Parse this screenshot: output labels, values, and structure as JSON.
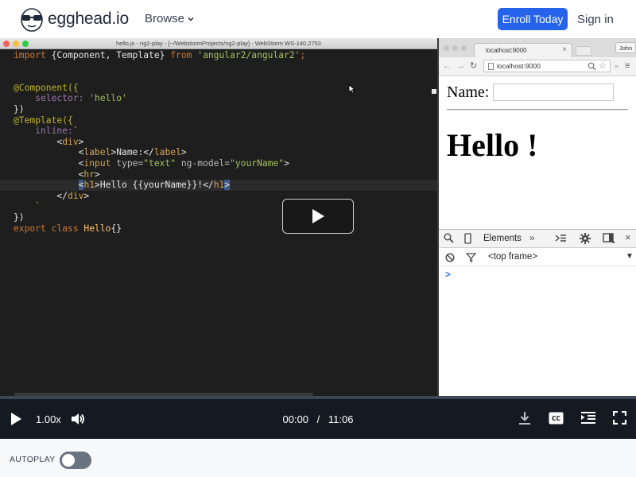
{
  "header": {
    "brand": "egghead.io",
    "browse_label": "Browse",
    "enroll_label": "Enroll Today",
    "signin_label": "Sign in"
  },
  "ide": {
    "window_title": "hello.js - ng2-play - [~/WebstormProjects/ng2-play] - WebStorm WS-140.2753"
  },
  "code_lines": [
    [
      {
        "t": "import ",
        "c": "kw2"
      },
      {
        "t": "{Component, Template} ",
        "c": ""
      },
      {
        "t": "from ",
        "c": "kw2"
      },
      {
        "t": "'angular2/angular2'",
        "c": "str"
      },
      {
        "t": ";",
        "c": "kw2"
      }
    ],
    [],
    [],
    [
      {
        "t": "@Component({",
        "c": "dec"
      }
    ],
    [
      {
        "t": "    selector: ",
        "c": "id"
      },
      {
        "t": "'hello'",
        "c": "str"
      }
    ],
    [
      {
        "t": "})",
        "c": ""
      }
    ],
    [
      {
        "t": "@Template({",
        "c": "dec"
      }
    ],
    [
      {
        "t": "    inline:",
        "c": "id"
      },
      {
        "t": "`",
        "c": "str"
      }
    ],
    [
      {
        "t": "        <",
        "c": ""
      },
      {
        "t": "div",
        "c": "tag"
      },
      {
        "t": ">",
        "c": ""
      }
    ],
    [
      {
        "t": "            <",
        "c": ""
      },
      {
        "t": "label",
        "c": "tag"
      },
      {
        "t": ">Name:</",
        "c": ""
      },
      {
        "t": "label",
        "c": "tag"
      },
      {
        "t": ">",
        "c": ""
      }
    ],
    [
      {
        "t": "            <",
        "c": ""
      },
      {
        "t": "input ",
        "c": "tag"
      },
      {
        "t": "type=",
        "c": "attr"
      },
      {
        "t": "\"text\" ",
        "c": "str"
      },
      {
        "t": "ng-model=",
        "c": "attr"
      },
      {
        "t": "\"yourName\"",
        "c": "str"
      },
      {
        "t": ">",
        "c": ""
      }
    ],
    [
      {
        "t": "            <",
        "c": ""
      },
      {
        "t": "hr",
        "c": "tag"
      },
      {
        "t": ">",
        "c": ""
      }
    ],
    [
      {
        "t": "            ",
        "c": ""
      },
      {
        "t": "<",
        "c": "sel-bg"
      },
      {
        "t": "h1",
        "c": "tag"
      },
      {
        "t": ">Hello {{yourName}}!</",
        "c": ""
      },
      {
        "t": "h1",
        "c": "tag"
      },
      {
        "t": ">",
        "c": "sel-bg"
      }
    ],
    [
      {
        "t": "        </",
        "c": ""
      },
      {
        "t": "div",
        "c": "tag"
      },
      {
        "t": ">",
        "c": ""
      }
    ],
    [
      {
        "t": "    `",
        "c": "str"
      }
    ],
    [
      {
        "t": "})",
        "c": ""
      }
    ],
    [
      {
        "t": "export class ",
        "c": "kw2"
      },
      {
        "t": "Hello",
        "c": "cls"
      },
      {
        "t": "{}",
        "c": ""
      }
    ]
  ],
  "browser": {
    "tab_title": "localhost:9000",
    "user_label": "John",
    "address": "localhost:9000",
    "page": {
      "name_label": "Name:",
      "name_value": "",
      "heading": "Hello !"
    },
    "devtools": {
      "panel_label": "Elements",
      "more_label": "»",
      "frame_label": "<top frame>",
      "prompt": ">"
    }
  },
  "player": {
    "speed": "1.00x",
    "current_time": "00:00",
    "time_separator": "/",
    "duration": "11:06",
    "progress_fraction": 0
  },
  "autoplay": {
    "label": "AUTOPLAY",
    "enabled": false
  }
}
